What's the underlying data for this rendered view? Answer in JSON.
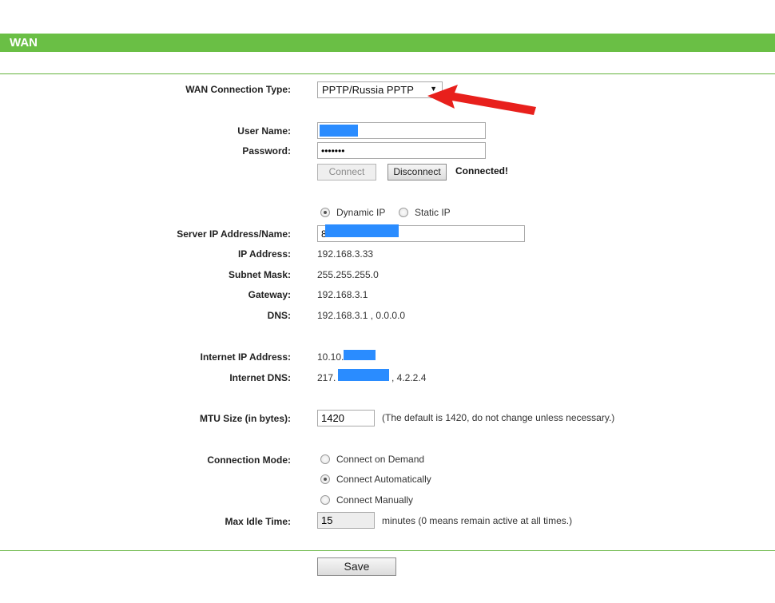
{
  "page": {
    "title": "WAN"
  },
  "wan_type": {
    "label": "WAN Connection Type:",
    "selected": "PPTP/Russia PPTP"
  },
  "auth": {
    "username_label": "User Name:",
    "username_value": "",
    "password_label": "Password:",
    "password_value": "•••••••",
    "connect_label": "Connect",
    "disconnect_label": "Disconnect",
    "status": "Connected!"
  },
  "ip_mode": {
    "dynamic_label": "Dynamic IP",
    "static_label": "Static IP",
    "selected": "dynamic"
  },
  "server": {
    "label": "Server IP Address/Name:",
    "value": "8"
  },
  "network": {
    "ip_label": "IP Address:",
    "ip_value": "192.168.3.33",
    "mask_label": "Subnet Mask:",
    "mask_value": "255.255.255.0",
    "gateway_label": "Gateway:",
    "gateway_value": "192.168.3.1",
    "dns_label": "DNS:",
    "dns_value": "192.168.3.1 , 0.0.0.0"
  },
  "internet": {
    "ip_label": "Internet IP Address:",
    "ip_value": "10.10.",
    "dns_label": "Internet DNS:",
    "dns_prefix": "217.",
    "dns_suffix": ", 4.2.2.4"
  },
  "mtu": {
    "label": "MTU Size (in bytes):",
    "value": "1420",
    "hint": "(The default is 1420, do not change unless necessary.)"
  },
  "conn_mode": {
    "label": "Connection Mode:",
    "on_demand": "Connect on Demand",
    "automatically": "Connect Automatically",
    "manually": "Connect Manually",
    "selected": "automatically"
  },
  "idle": {
    "label": "Max Idle Time:",
    "value": "15",
    "hint": "minutes (0 means remain active at all times.)"
  },
  "save_label": "Save",
  "colors": {
    "header": "#6abf45",
    "rule": "#63b33c",
    "redaction": "#2a8cff",
    "annotation_arrow": "#e8201c"
  }
}
